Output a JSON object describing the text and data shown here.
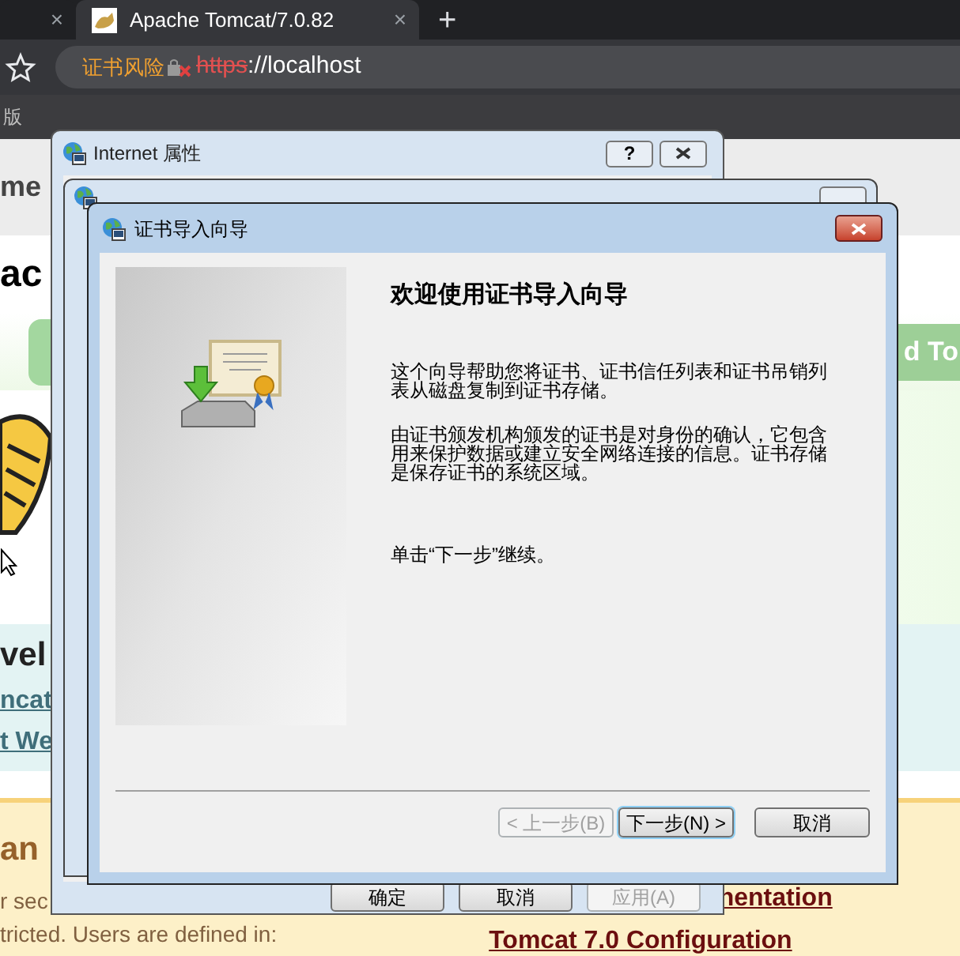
{
  "browser": {
    "tabs": [
      {
        "selected": false,
        "close_glyph": "×"
      },
      {
        "title": "Apache Tomcat/7.0.82",
        "selected": true,
        "close_glyph": "×"
      }
    ],
    "new_tab": "+",
    "address": {
      "warning": "证书风险",
      "scheme": "https",
      "rest": "://localhost"
    },
    "bookmark": "版"
  },
  "page": {
    "nav_fragment": "me",
    "heading_fragment": "ac",
    "banner_fragment": "d To",
    "section_heading": "vel",
    "links": [
      "ncat",
      "t We"
    ],
    "manager": {
      "heading": "an",
      "lines": [
        "r sec",
        "tricted. Users are defined in:"
      ],
      "links": [
        "nentation",
        "Tomcat 7.0 Configuration"
      ]
    }
  },
  "internet_options": {
    "title": "Internet 属性",
    "help_glyph": "?",
    "buttons": [
      {
        "label": "确定",
        "disabled": false
      },
      {
        "label": "取消",
        "disabled": false
      },
      {
        "label": "应用(A)",
        "disabled": true
      }
    ]
  },
  "wizard": {
    "title": "证书导入向导",
    "heading": "欢迎使用证书导入向导",
    "paragraphs": [
      "这个向导帮助您将证书、证书信任列表和证书吊销列表从磁盘复制到证书存储。",
      "由证书颁发机构颁发的证书是对身份的确认，它包含用来保护数据或建立安全网络连接的信息。证书存储是保存证书的系统区域。",
      "单击“下一步”继续。"
    ],
    "buttons": [
      {
        "label": "< 上一步(B)",
        "disabled": true,
        "focused": false
      },
      {
        "label": "下一步(N) >",
        "disabled": false,
        "focused": true
      },
      {
        "label": "取消",
        "disabled": false,
        "focused": false
      }
    ]
  }
}
